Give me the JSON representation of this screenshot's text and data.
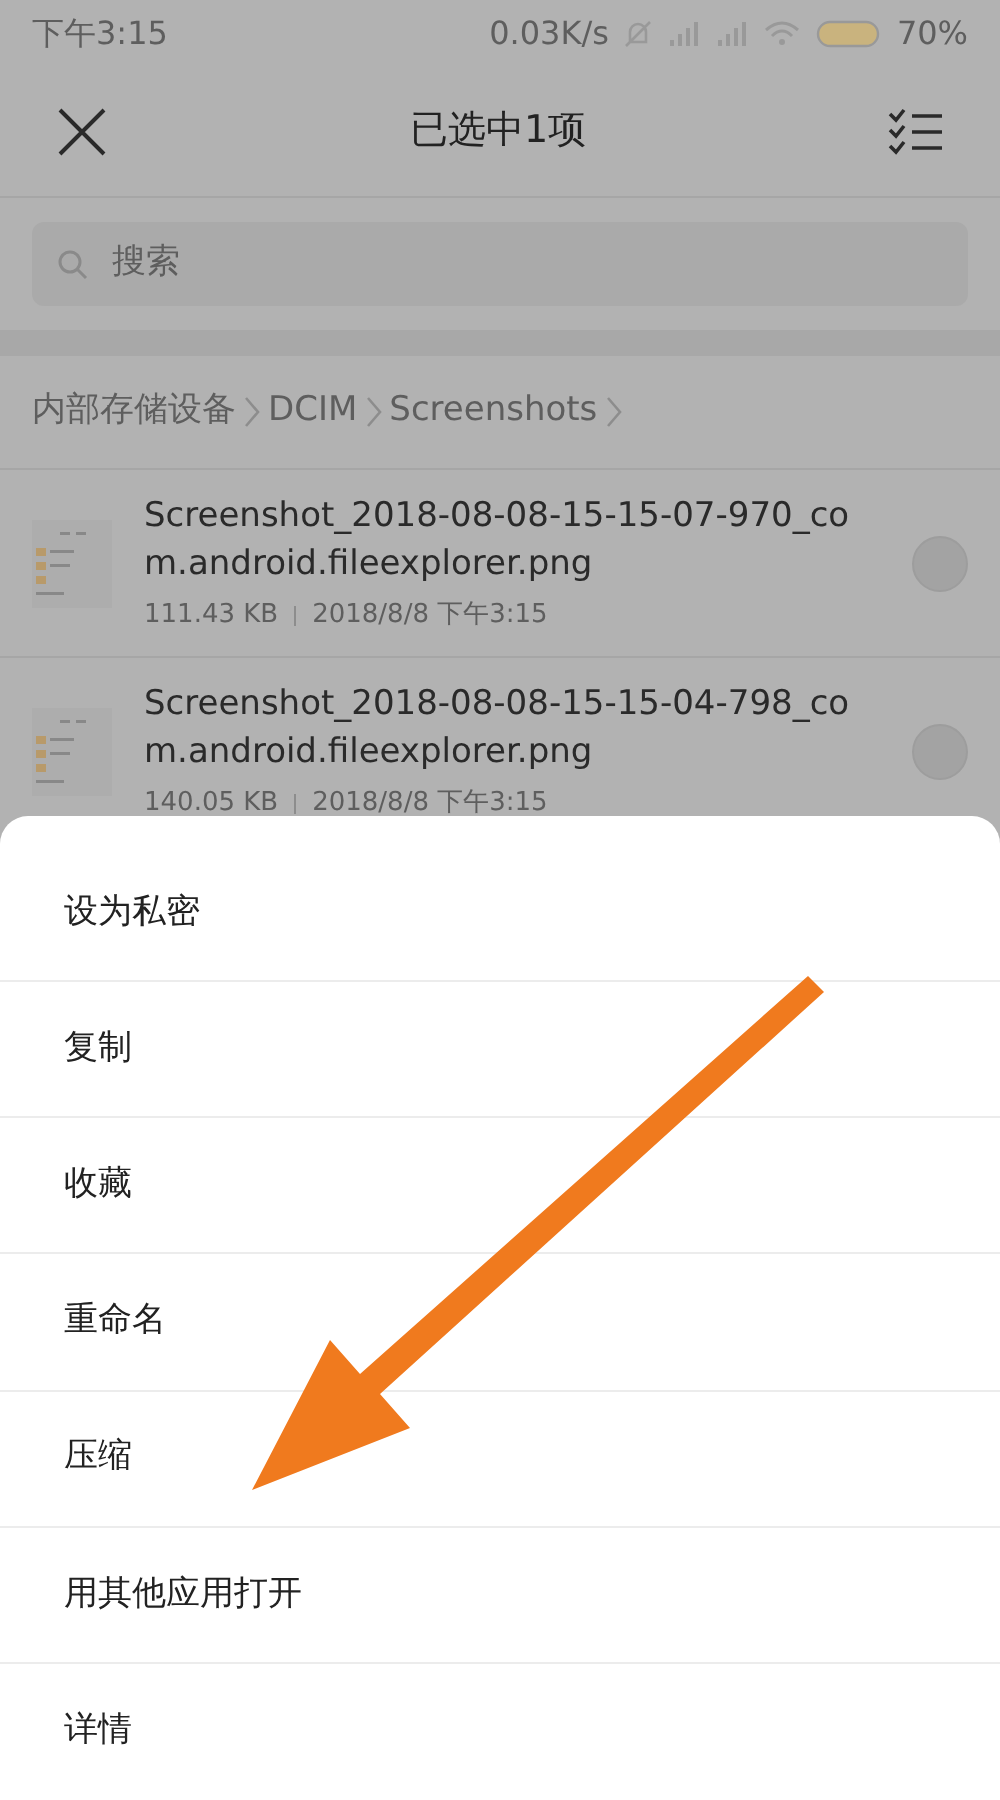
{
  "status_bar": {
    "time": "下午3:15",
    "speed": "0.03K/s",
    "battery": "70%"
  },
  "header": {
    "title": "已选中1项"
  },
  "search": {
    "placeholder": "搜索"
  },
  "breadcrumb": [
    "内部存储设备",
    "DCIM",
    "Screenshots"
  ],
  "files": [
    {
      "name": "Screenshot_2018-08-08-15-15-07-970_com.android.fileexplorer.png",
      "size": "111.43 KB",
      "date": "2018/8/8 下午3:15",
      "selected": false
    },
    {
      "name": "Screenshot_2018-08-08-15-15-04-798_com.android.fileexplorer.png",
      "size": "140.05 KB",
      "date": "2018/8/8 下午3:15",
      "selected": false
    }
  ],
  "menu": [
    "设为私密",
    "复制",
    "收藏",
    "重命名",
    "压缩",
    "用其他应用打开",
    "详情"
  ]
}
